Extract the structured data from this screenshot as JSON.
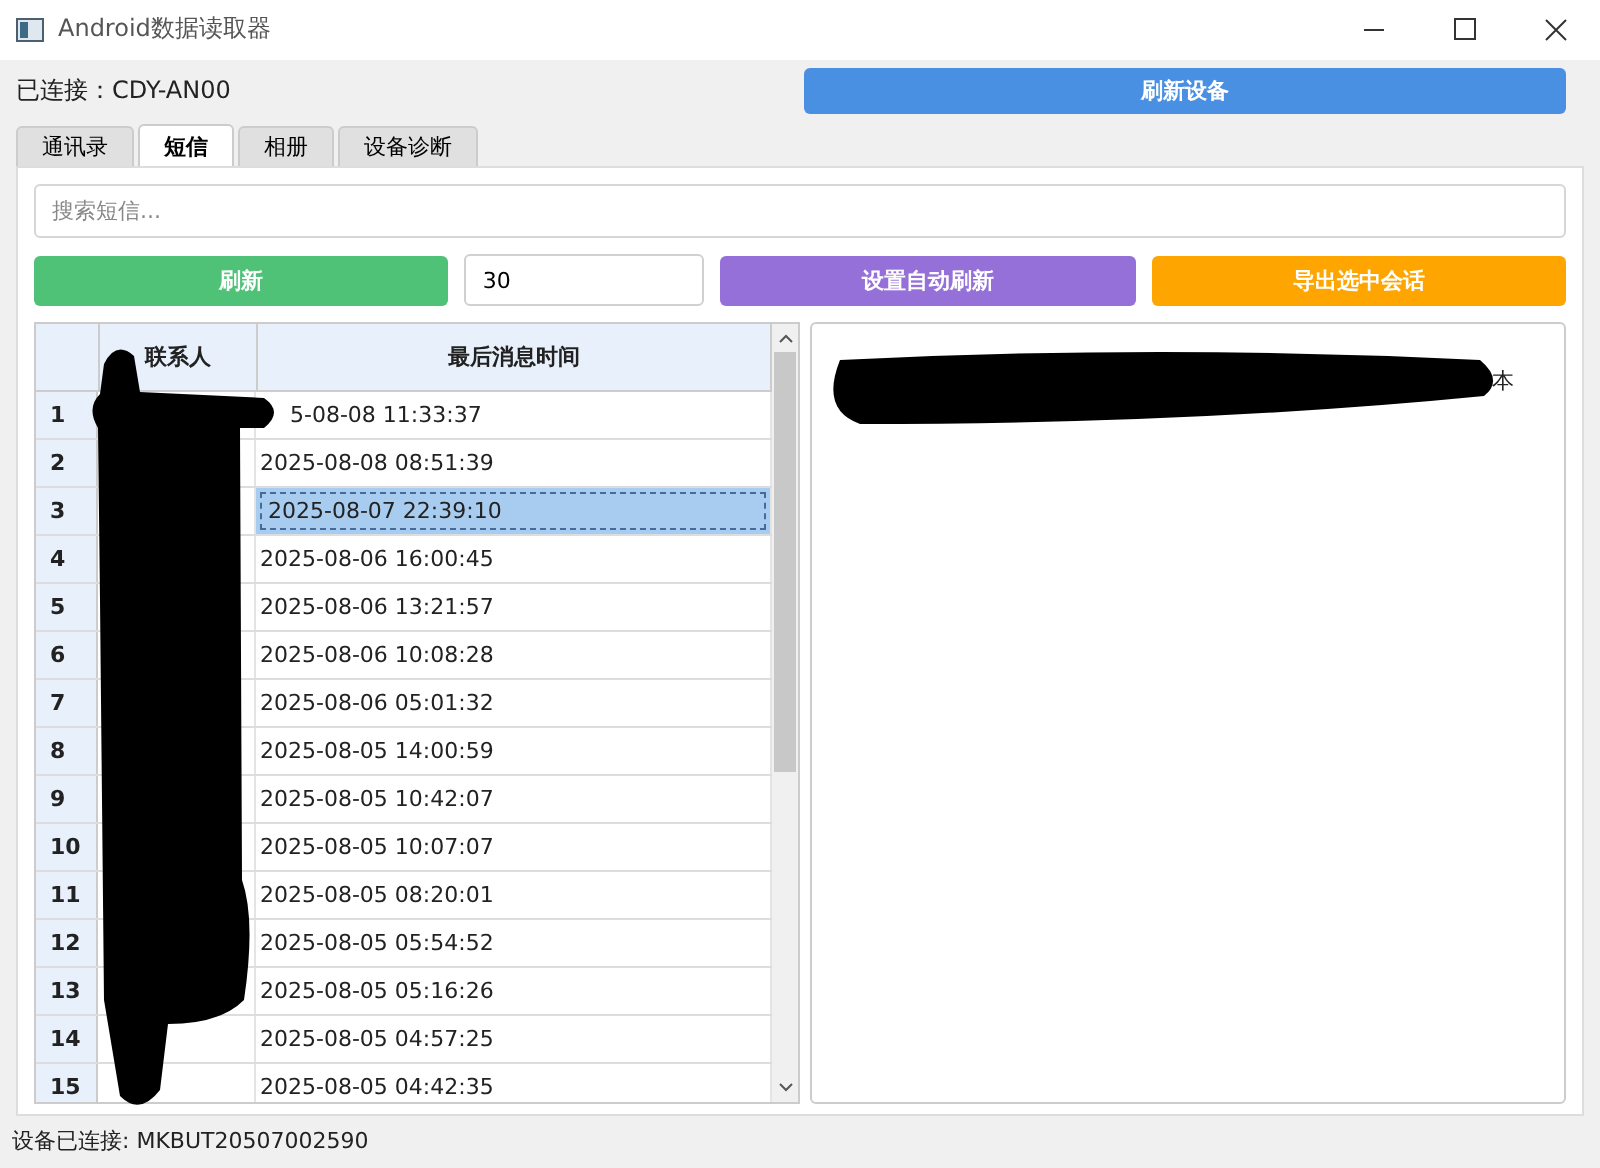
{
  "window": {
    "title": "Android数据读取器"
  },
  "connection_label": "已连接：CDY-AN00",
  "refresh_device_button": "刷新设备",
  "tabs": [
    {
      "label": "通讯录",
      "selected": false
    },
    {
      "label": "短信",
      "selected": true
    },
    {
      "label": "相册",
      "selected": false
    },
    {
      "label": "设备诊断",
      "selected": false
    }
  ],
  "search": {
    "placeholder": "搜索短信..."
  },
  "refresh_button": "刷新",
  "interval_value": "30",
  "auto_refresh_button": "设置自动刷新",
  "export_button": "导出选中会话",
  "table": {
    "columns": [
      "联系人",
      "最后消息时间"
    ],
    "rows": [
      {
        "number": "1",
        "time": "5-08-08 11:33:37",
        "selected": false
      },
      {
        "number": "2",
        "time": "2025-08-08 08:51:39",
        "selected": false
      },
      {
        "number": "3",
        "time": "2025-08-07 22:39:10",
        "selected": true
      },
      {
        "number": "4",
        "time": "2025-08-06 16:00:45",
        "selected": false
      },
      {
        "number": "5",
        "time": "2025-08-06 13:21:57",
        "selected": false
      },
      {
        "number": "6",
        "time": "2025-08-06 10:08:28",
        "selected": false
      },
      {
        "number": "7",
        "time": "2025-08-06 05:01:32",
        "selected": false
      },
      {
        "number": "8",
        "time": "2025-08-05 14:00:59",
        "selected": false
      },
      {
        "number": "9",
        "time": "2025-08-05 10:42:07",
        "selected": false
      },
      {
        "number": "10",
        "time": "2025-08-05 10:07:07",
        "selected": false
      },
      {
        "number": "11",
        "time": "2025-08-05 08:20:01",
        "selected": false
      },
      {
        "number": "12",
        "time": "2025-08-05 05:54:52",
        "selected": false
      },
      {
        "number": "13",
        "time": "2025-08-05 05:16:26",
        "selected": false
      },
      {
        "number": "14",
        "time": "2025-08-05 04:57:25",
        "selected": false
      },
      {
        "number": "15",
        "time": "2025-08-05 04:42:35",
        "selected": false
      }
    ]
  },
  "message_view": {
    "visible_text": "本"
  },
  "status_bar": "设备已连接: MKBUT20507002590"
}
